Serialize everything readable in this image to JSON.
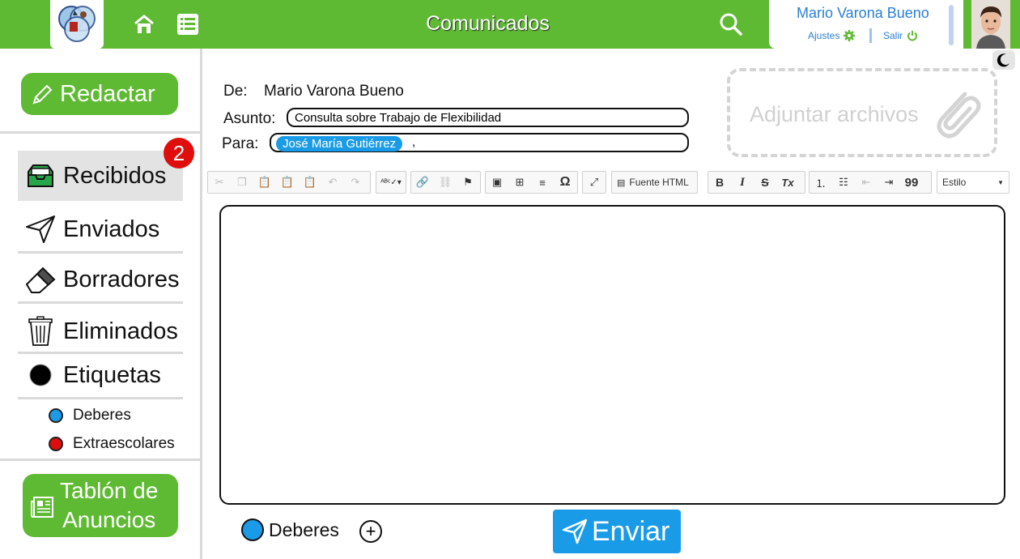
{
  "app": {
    "title": "Comunicados"
  },
  "user": {
    "name": "Mario Varona Bueno",
    "settings_label": "Ajustes",
    "logout_label": "Salir"
  },
  "sidebar": {
    "compose_label": "Redactar",
    "items": [
      {
        "label": "Recibidos",
        "icon": "inbox-icon"
      },
      {
        "label": "Enviados",
        "icon": "paper-plane-icon"
      },
      {
        "label": "Borradores",
        "icon": "eraser-icon"
      },
      {
        "label": "Eliminados",
        "icon": "trash-icon"
      },
      {
        "label": "Etiquetas",
        "icon": "tag-circle-icon"
      }
    ],
    "unread_badge": "2",
    "tags": [
      {
        "label": "Deberes",
        "color": "#1a9be8"
      },
      {
        "label": "Extraescolares",
        "color": "#e00d0d"
      }
    ],
    "board_label_line1": "Tablón de",
    "board_label_line2": "Anuncios"
  },
  "message": {
    "from_label": "De:",
    "from_value": "Mario Varona Bueno",
    "subject_label": "Asunto:",
    "subject_value": "Consulta sobre Trabajo de Flexibilidad",
    "to_label": "Para:",
    "to_chip": "José María Gutiérrez",
    "to_trailing": ",",
    "attach_label": "Adjuntar archivos"
  },
  "toolbar": {
    "html_source_label": "Fuente HTML",
    "style_select": "Estilo",
    "bold": "B",
    "italic": "I",
    "strike": "S",
    "clear_format": "Tx",
    "quote": "99",
    "special_char": "Ω"
  },
  "footer": {
    "tag_label": "Deberes",
    "tag_color": "#1a9be8",
    "send_label": "Enviar"
  },
  "colors": {
    "brand_green": "#5fba33",
    "accent_blue": "#1a9be8",
    "badge_red": "#e00d0d"
  }
}
